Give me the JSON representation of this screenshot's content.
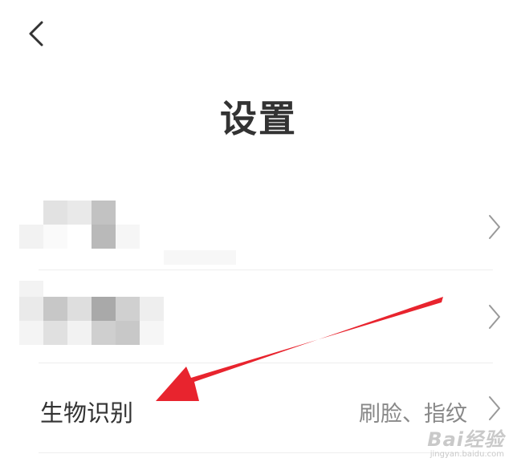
{
  "header": {
    "back_icon": "chevron-left-icon",
    "title": "设置"
  },
  "rows": [
    {
      "label": "",
      "value": "",
      "blurred": true
    },
    {
      "label": "",
      "value": "",
      "blurred": true
    },
    {
      "label": "生物识别",
      "value": "刷脸、指纹"
    }
  ],
  "annotation": {
    "arrow_color": "#e8242e"
  },
  "watermark": {
    "brand": "Bai经验",
    "url": "jingyan.baidu.com"
  },
  "colors": {
    "text": "#333333",
    "secondary": "#888888",
    "divider": "#eeeeee"
  }
}
